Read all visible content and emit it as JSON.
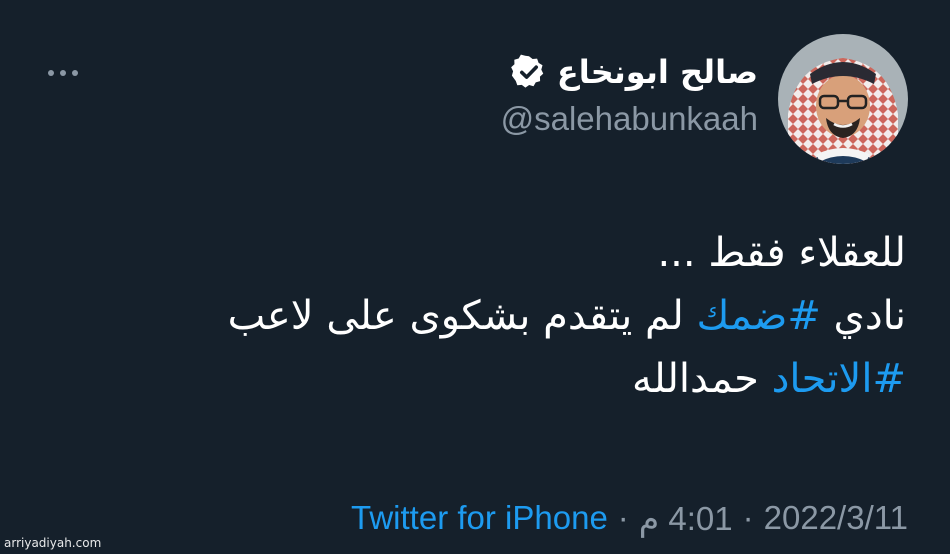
{
  "tweet": {
    "display_name": "صالح ابونخاع",
    "handle": "@salehabunkaah",
    "lines": [
      {
        "text": "للعقلاء فقط ..."
      },
      {
        "text": "نادي ",
        "hashtag": "#ضمك",
        "after": " لم يتقدم بشكوى على لاعب"
      },
      {
        "hashtag": "#الاتحاد",
        "after": " حمدالله"
      }
    ],
    "timestamp": "4:01 م",
    "date": "2022/3/11",
    "separator": "·",
    "source": "Twitter for iPhone"
  },
  "watermark": "arriyadiyah.com",
  "colors": {
    "background": "#15202b",
    "text": "#ffffff",
    "secondary": "#8b98a5",
    "link": "#1d9bf0"
  },
  "icons": [
    "more-horizontal-icon",
    "verified-badge-icon"
  ]
}
